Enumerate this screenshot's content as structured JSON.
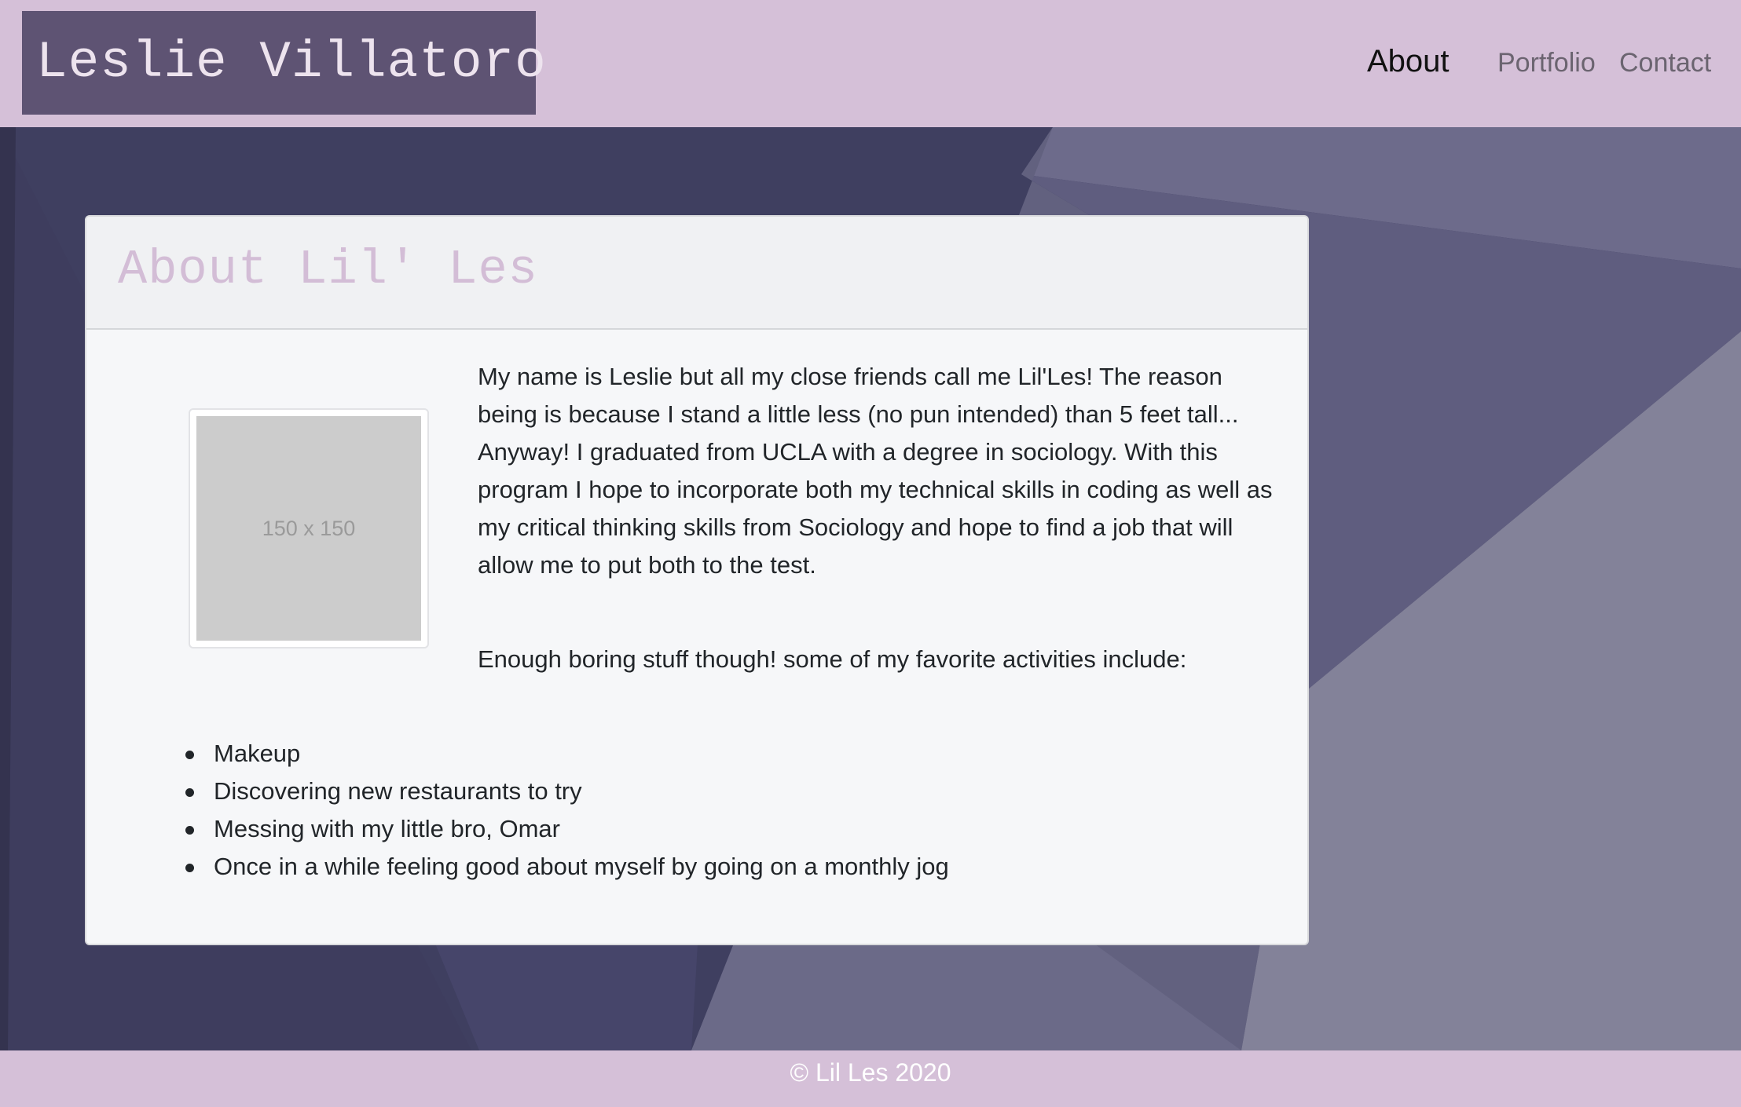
{
  "header": {
    "brand": "Leslie Villatoro",
    "nav": {
      "about": "About",
      "portfolio": "Portfolio",
      "contact": "Contact"
    }
  },
  "about": {
    "title": "About Lil' Les",
    "image_placeholder": "150 x 150",
    "bio": "My name is Leslie but all my close friends call me Lil'Les! The reason being is because I stand a little less (no pun intended) than 5 feet tall... Anyway! I graduated from UCLA with a degree in sociology. With this program I hope to incorporate both my technical skills in coding as well as my critical thinking skills from Sociology and hope to find a job that will allow me to put both to the test.",
    "activities_intro": "Enough boring stuff though! some of my favorite activities include:",
    "activities": [
      "Makeup",
      "Discovering new restaurants to try",
      "Messing with my little bro, Omar",
      "Once in a while feeling good about myself by going on a monthly jog"
    ]
  },
  "footer": {
    "copyright": "© Lil Les 2020"
  },
  "colors": {
    "header_bg": "#d5c0d8",
    "brand_bg": "#5e5373",
    "title_color": "#d3bdd6",
    "background_dark": "#3f3e5f",
    "background_light": "#8887a5"
  }
}
